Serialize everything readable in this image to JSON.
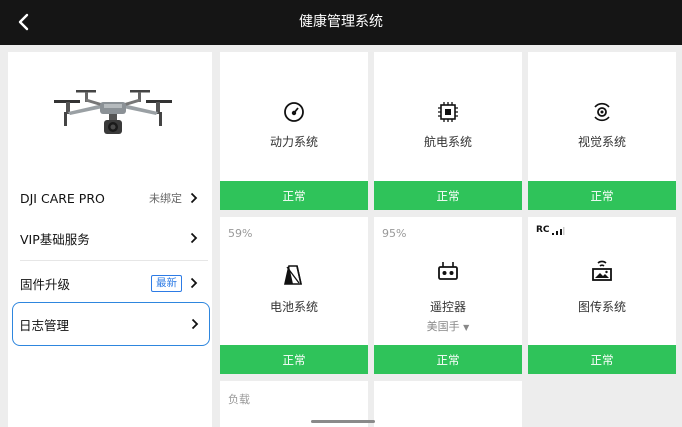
{
  "header": {
    "title": "健康管理系统"
  },
  "sidebar": {
    "items": [
      {
        "label": "DJI CARE PRO",
        "status": "未绑定"
      },
      {
        "label": "VIP基础服务"
      },
      {
        "label": "固件升级",
        "badge": "最新"
      },
      {
        "label": "日志管理"
      }
    ]
  },
  "cards": [
    {
      "name": "动力系统",
      "status": "正常",
      "icon": "propulsion-icon"
    },
    {
      "name": "航电系统",
      "status": "正常",
      "icon": "avionics-chip-icon"
    },
    {
      "name": "视觉系统",
      "status": "正常",
      "icon": "vision-sensor-icon"
    },
    {
      "name": "电池系统",
      "status": "正常",
      "percent": "59%",
      "icon": "battery-icon"
    },
    {
      "name": "遥控器",
      "status": "正常",
      "percent": "95%",
      "sub": "美国手",
      "icon": "remote-controller-icon"
    },
    {
      "name": "图传系统",
      "status": "正常",
      "signal": "RC",
      "icon": "image-transmission-icon"
    },
    {
      "name": "负载"
    }
  ],
  "colors": {
    "ok": "#2fc35a",
    "accent": "#2e86de",
    "header_bg": "#151515"
  }
}
